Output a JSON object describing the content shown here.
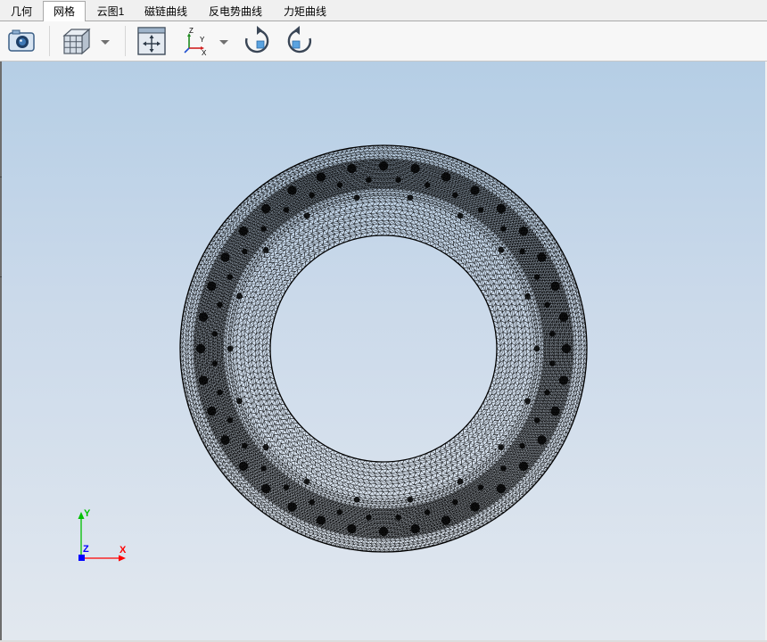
{
  "tabs": [
    {
      "label": "几何",
      "active": false
    },
    {
      "label": "网格",
      "active": true
    },
    {
      "label": "云图1",
      "active": false
    },
    {
      "label": "磁链曲线",
      "active": false
    },
    {
      "label": "反电势曲线",
      "active": false
    },
    {
      "label": "力矩曲线",
      "active": false
    }
  ],
  "toolbar": {
    "buttons": [
      {
        "icon": "camera-icon"
      },
      {
        "icon": "cube-view-icon",
        "has_dropdown": true
      },
      {
        "icon": "fit-view-icon"
      },
      {
        "icon": "axis-orientation-icon",
        "has_dropdown": true
      },
      {
        "icon": "rotate-clockwise-icon"
      },
      {
        "icon": "rotate-counterclockwise-icon"
      }
    ],
    "axis_icon_labels": {
      "z": "Z",
      "y": "Y",
      "x": "X"
    }
  },
  "viewport": {
    "content": "finite element mesh of annular cross-section",
    "triad": {
      "x_label": "X",
      "y_label": "Y",
      "z_label": "Z"
    },
    "colors": {
      "background_top": "#b5cee5",
      "background_bottom": "#e2e8ef",
      "mesh": "#000000",
      "x_axis": "#ff0000",
      "y_axis": "#00c000",
      "z_axis": "#0000ff"
    }
  }
}
